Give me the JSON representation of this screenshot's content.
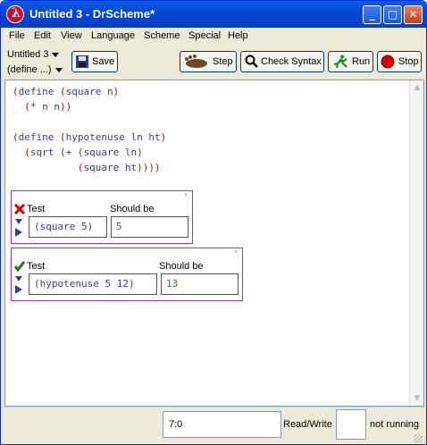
{
  "window": {
    "title": "Untitled 3 - DrScheme*"
  },
  "menu": [
    "File",
    "Edit",
    "View",
    "Language",
    "Scheme",
    "Special",
    "Help"
  ],
  "toolbar": {
    "file_dropdown": "Untitled 3",
    "define_dropdown": "(define ...)",
    "save": "Save",
    "step": "Step",
    "check_syntax": "Check Syntax",
    "run": "Run",
    "stop": "Stop"
  },
  "editor": {
    "lines": [
      "(define (square n)",
      "  (* n n))",
      "",
      "(define (hypotenuse ln ht)",
      "  (sqrt (+ (square ln)",
      "           (square ht))))"
    ],
    "tests": [
      {
        "status": "fail",
        "test_label": "Test",
        "should_label": "Should be",
        "test": "(square 5)",
        "should": "5",
        "mark": "'"
      },
      {
        "status": "pass",
        "test_label": "Test",
        "should_label": "Should be",
        "test": "(hypotenuse 5 12)",
        "should": "13",
        "mark": "'"
      }
    ]
  },
  "status": {
    "position": "7:0",
    "mode": "Read/Write",
    "state": "not running"
  }
}
